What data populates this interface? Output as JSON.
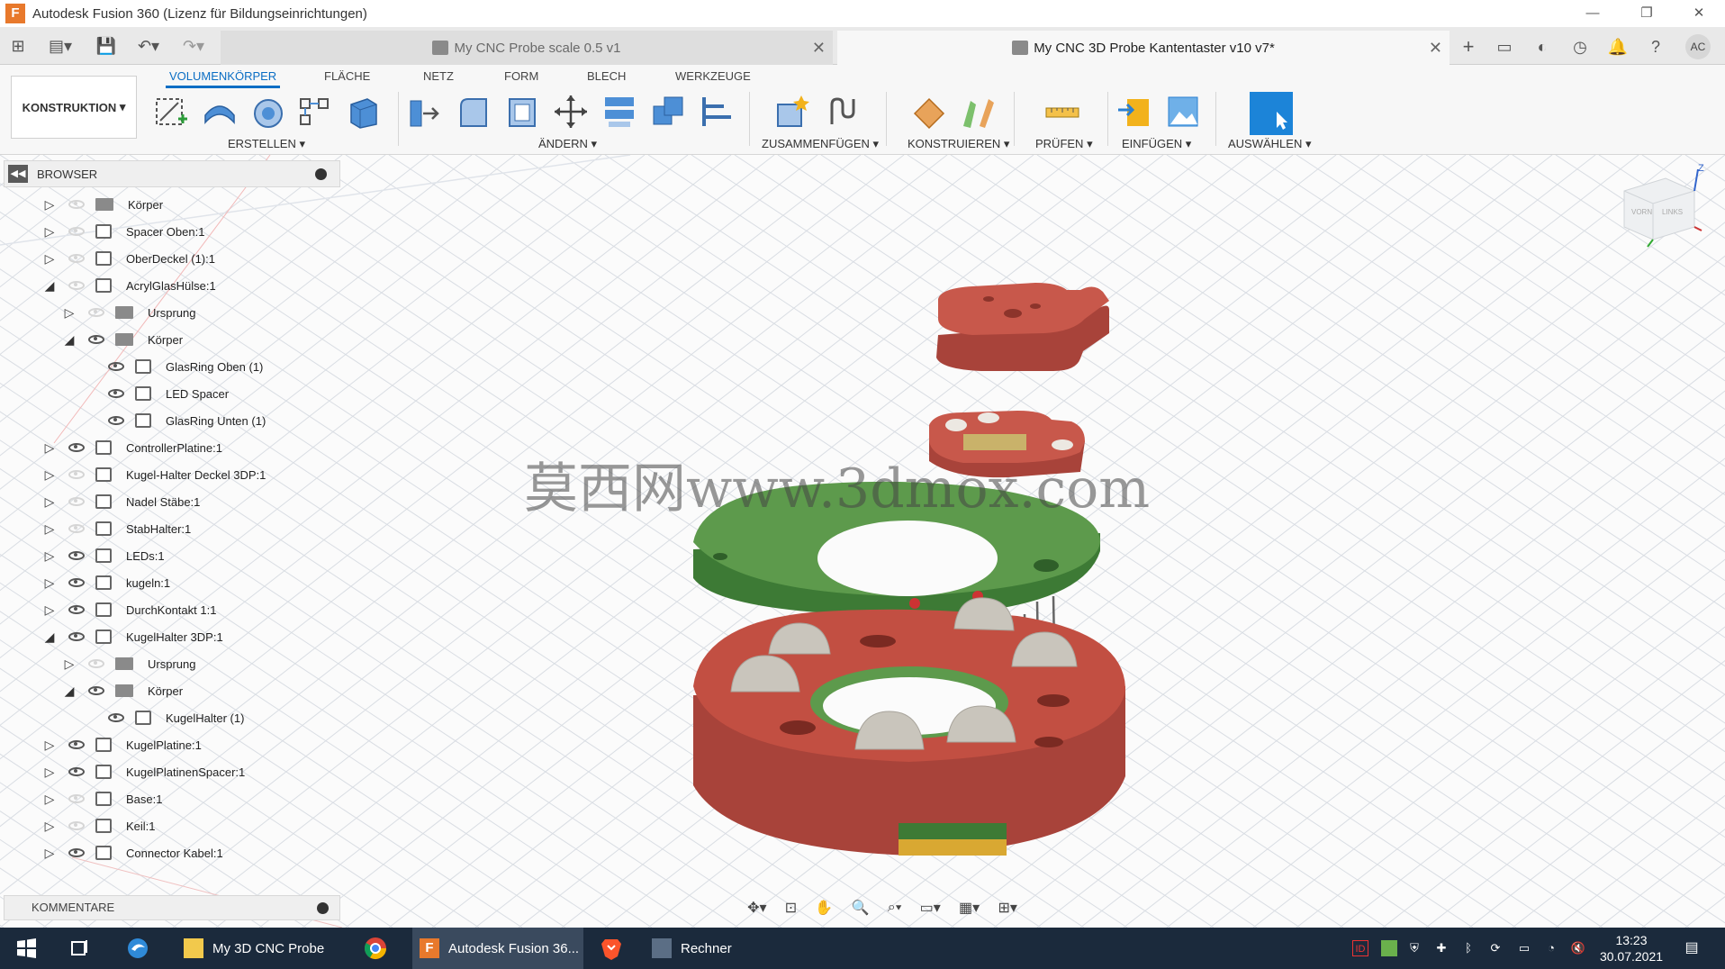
{
  "window": {
    "title": "Autodesk Fusion 360 (Lizenz für Bildungseinrichtungen)",
    "app_icon_letter": "F",
    "minimize_glyph": "—",
    "restore_glyph": "❐",
    "close_glyph": "✕"
  },
  "tabs": [
    {
      "label": "My CNC Probe scale 0.5 v1",
      "active": false
    },
    {
      "label": "My CNC 3D Probe Kantentaster v10 v7*",
      "active": true
    }
  ],
  "user_initials": "AC",
  "ribbon": {
    "workspace": "KONSTRUKTION",
    "tabs": [
      "VOLUMENKÖRPER",
      "FLÄCHE",
      "NETZ",
      "FORM",
      "BLECH",
      "WERKZEUGE"
    ],
    "groups": [
      "ERSTELLEN",
      "ÄNDERN",
      "ZUSAMMENFÜGEN",
      "KONSTRUIEREN",
      "PRÜFEN",
      "EINFÜGEN",
      "AUSWÄHLEN"
    ]
  },
  "browser": {
    "title": "BROWSER",
    "nodes": [
      {
        "label": "Körper",
        "level": 0,
        "expander": "▷",
        "visible": "hidden",
        "kind": "folder"
      },
      {
        "label": "Spacer Oben:1",
        "level": 0,
        "expander": "▷",
        "visible": "hidden",
        "kind": "comp"
      },
      {
        "label": "OberDeckel (1):1",
        "level": 0,
        "expander": "▷",
        "visible": "hidden",
        "kind": "comp"
      },
      {
        "label": "AcrylGlasHülse:1",
        "level": 0,
        "expander": "◢",
        "visible": "hidden",
        "kind": "comp"
      },
      {
        "label": "Ursprung",
        "level": 1,
        "expander": "▷",
        "visible": "hidden",
        "kind": "folder"
      },
      {
        "label": "Körper",
        "level": 1,
        "expander": "◢",
        "visible": "on",
        "kind": "folder"
      },
      {
        "label": "GlasRing Oben (1)",
        "level": 2,
        "expander": "",
        "visible": "on",
        "kind": "comp"
      },
      {
        "label": "LED Spacer",
        "level": 2,
        "expander": "",
        "visible": "on",
        "kind": "comp"
      },
      {
        "label": "GlasRing Unten (1)",
        "level": 2,
        "expander": "",
        "visible": "on",
        "kind": "comp"
      },
      {
        "label": "ControllerPlatine:1",
        "level": 0,
        "expander": "▷",
        "visible": "on",
        "kind": "comp"
      },
      {
        "label": "Kugel-Halter Deckel 3DP:1",
        "level": 0,
        "expander": "▷",
        "visible": "hidden",
        "kind": "comp"
      },
      {
        "label": "Nadel Stäbe:1",
        "level": 0,
        "expander": "▷",
        "visible": "hidden",
        "kind": "comp"
      },
      {
        "label": "StabHalter:1",
        "level": 0,
        "expander": "▷",
        "visible": "hidden",
        "kind": "comp"
      },
      {
        "label": "LEDs:1",
        "level": 0,
        "expander": "▷",
        "visible": "on",
        "kind": "comp"
      },
      {
        "label": "kugeln:1",
        "level": 0,
        "expander": "▷",
        "visible": "on",
        "kind": "comp"
      },
      {
        "label": "DurchKontakt 1:1",
        "level": 0,
        "expander": "▷",
        "visible": "on",
        "kind": "comp"
      },
      {
        "label": "KugelHalter 3DP:1",
        "level": 0,
        "expander": "◢",
        "visible": "on",
        "kind": "comp"
      },
      {
        "label": "Ursprung",
        "level": 1,
        "expander": "▷",
        "visible": "hidden",
        "kind": "folder"
      },
      {
        "label": "Körper",
        "level": 1,
        "expander": "◢",
        "visible": "on",
        "kind": "folder"
      },
      {
        "label": "KugelHalter (1)",
        "level": 2,
        "expander": "",
        "visible": "on",
        "kind": "comp"
      },
      {
        "label": "KugelPlatine:1",
        "level": 0,
        "expander": "▷",
        "visible": "on",
        "kind": "comp"
      },
      {
        "label": "KugelPlatinenSpacer:1",
        "level": 0,
        "expander": "▷",
        "visible": "on",
        "kind": "comp"
      },
      {
        "label": "Base:1",
        "level": 0,
        "expander": "▷",
        "visible": "hidden",
        "kind": "comp"
      },
      {
        "label": "Keil:1",
        "level": 0,
        "expander": "▷",
        "visible": "hidden",
        "kind": "comp"
      },
      {
        "label": "Connector Kabel:1",
        "level": 0,
        "expander": "▷",
        "visible": "on",
        "kind": "comp"
      }
    ]
  },
  "comments": {
    "title": "KOMMENTARE"
  },
  "viewcube": {
    "left": "LINKS",
    "front": "VORN",
    "axis": "Z"
  },
  "watermark": "莫西网www.3dmox.com",
  "taskbar": {
    "items": [
      {
        "label": "My 3D CNC Probe"
      },
      {
        "label": "Autodesk Fusion 36..."
      },
      {
        "label": "Rechner"
      }
    ],
    "time": "13:23",
    "date": "30.07.2021"
  },
  "colors": {
    "accent_blue": "#0b6ec4",
    "part_red": "#b84a3c",
    "part_green": "#5d9a4c",
    "taskbar": "#1b2a3c"
  }
}
